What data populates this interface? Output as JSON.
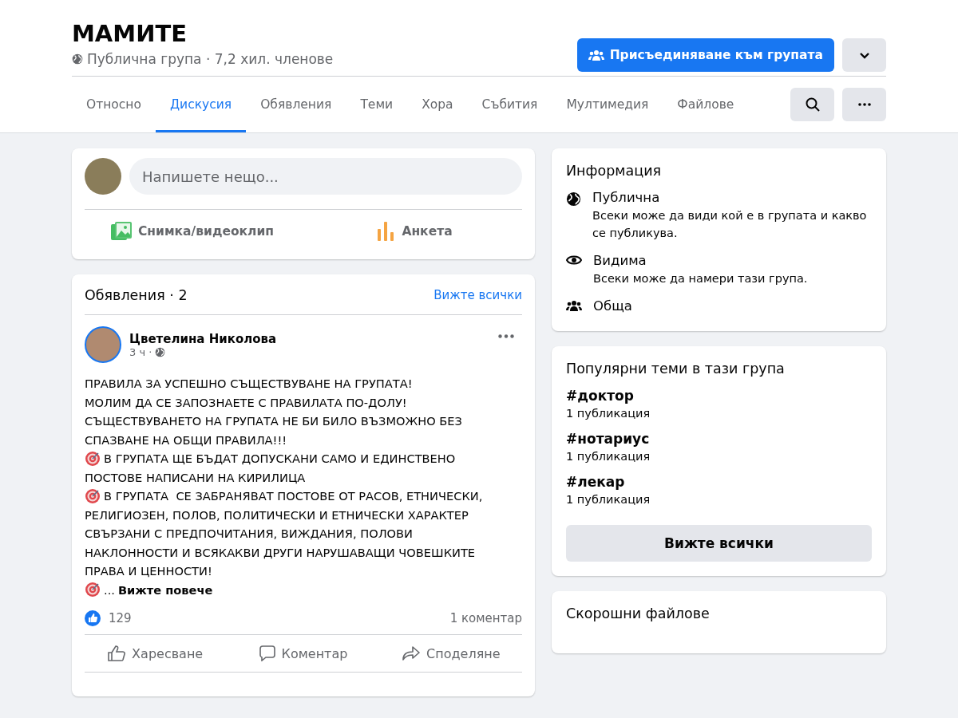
{
  "group": {
    "name": "МАМИТЕ",
    "meta": "Публична група · 7,2 хил. членове",
    "join_button": "Присъединяване към групата"
  },
  "tabs": [
    {
      "label": "Относно",
      "selected": false
    },
    {
      "label": "Дискусия",
      "selected": true
    },
    {
      "label": "Обявления",
      "selected": false
    },
    {
      "label": "Теми",
      "selected": false
    },
    {
      "label": "Хора",
      "selected": false
    },
    {
      "label": "Събития",
      "selected": false
    },
    {
      "label": "Мултимедия",
      "selected": false
    },
    {
      "label": "Файлове",
      "selected": false
    }
  ],
  "composer": {
    "placeholder": "Напишете нещо...",
    "actions": [
      {
        "kind": "photo",
        "label": "Снимка/видеоклип"
      },
      {
        "kind": "poll",
        "label": "Анкета"
      }
    ]
  },
  "announcements": {
    "title": "Обявления · 2",
    "see_all": "Вижте всички",
    "post": {
      "author": "Цветелина Николова",
      "time": "3 ч ·",
      "lines": [
        {
          "text": "ПРАВИЛА ЗА УСПЕШНО СЪЩЕСТВУВАНЕ НА ГРУПАТА!",
          "bullet": false
        },
        {
          "text": "МОЛИМ ДА СЕ ЗАПОЗНАЕТЕ С ПРАВИЛАТА ПО-ДОЛУ!",
          "bullet": false
        },
        {
          "text": "СЪЩЕСТВУВАНЕТО НА ГРУПАТА НЕ БИ БИЛО ВЪЗМОЖНО БЕЗ",
          "bullet": false
        },
        {
          "text": "СПАЗВАНЕ НА ОБЩИ ПРАВИЛА!!!",
          "bullet": false
        },
        {
          "text": "В ГРУПАТА ЩЕ БЪДАТ ДОПУСКАНИ САМО И ЕДИНСТВЕНО",
          "bullet": true
        },
        {
          "text": "ПОСТОВЕ НАПИСАНИ НА КИРИЛИЦА",
          "bullet": false
        },
        {
          "text": "В ГРУПАТА  СЕ ЗАБРАНЯВАТ ПОСТОВЕ ОТ РАСОВ, ЕТНИЧЕСКИ,",
          "bullet": true
        },
        {
          "text": "РЕЛИГИОЗЕН, ПОЛОВ, ПОЛИТИЧЕСКИ И ЕТНИЧЕСКИ ХАРАКТЕР",
          "bullet": false
        },
        {
          "text": "СВЪРЗАНИ С ПРЕДПОЧИТАНИЯ, ВИЖДАНИЯ, ПОЛОВИ",
          "bullet": false
        },
        {
          "text": "НАКЛОННОСТИ И ВСЯКАКВИ ДРУГИ НАРУШАВАЩИ ЧОВЕШКИТЕ",
          "bullet": false
        },
        {
          "text": "ПРАВА И ЦЕННОСТИ!",
          "bullet": false
        }
      ],
      "more": {
        "prefix": "...",
        "link": "Вижте повече"
      },
      "likes": "129",
      "comments": "1 коментар",
      "actions": [
        {
          "kind": "like",
          "label": "Харесване"
        },
        {
          "kind": "comment",
          "label": "Коментар"
        },
        {
          "kind": "share",
          "label": "Споделяне"
        }
      ]
    }
  },
  "info": {
    "title": "Информация",
    "items": [
      {
        "kind": "globe",
        "title": "Публична",
        "description": "Всеки може да види кой е в групата и какво се публикува."
      },
      {
        "kind": "eye",
        "title": "Видима",
        "description": "Всеки може да намери тази група."
      },
      {
        "kind": "people",
        "title": "Обща"
      }
    ]
  },
  "topics": {
    "title": "Популярни теми в тази група",
    "items": [
      {
        "tag": "#доктор",
        "count": "1 публикация"
      },
      {
        "tag": "#нотариус",
        "count": "1 публикация"
      },
      {
        "tag": "#лекар",
        "count": "1 публикация"
      }
    ],
    "button": "Вижте всички"
  },
  "files": {
    "title": "Скорошни файлове"
  }
}
